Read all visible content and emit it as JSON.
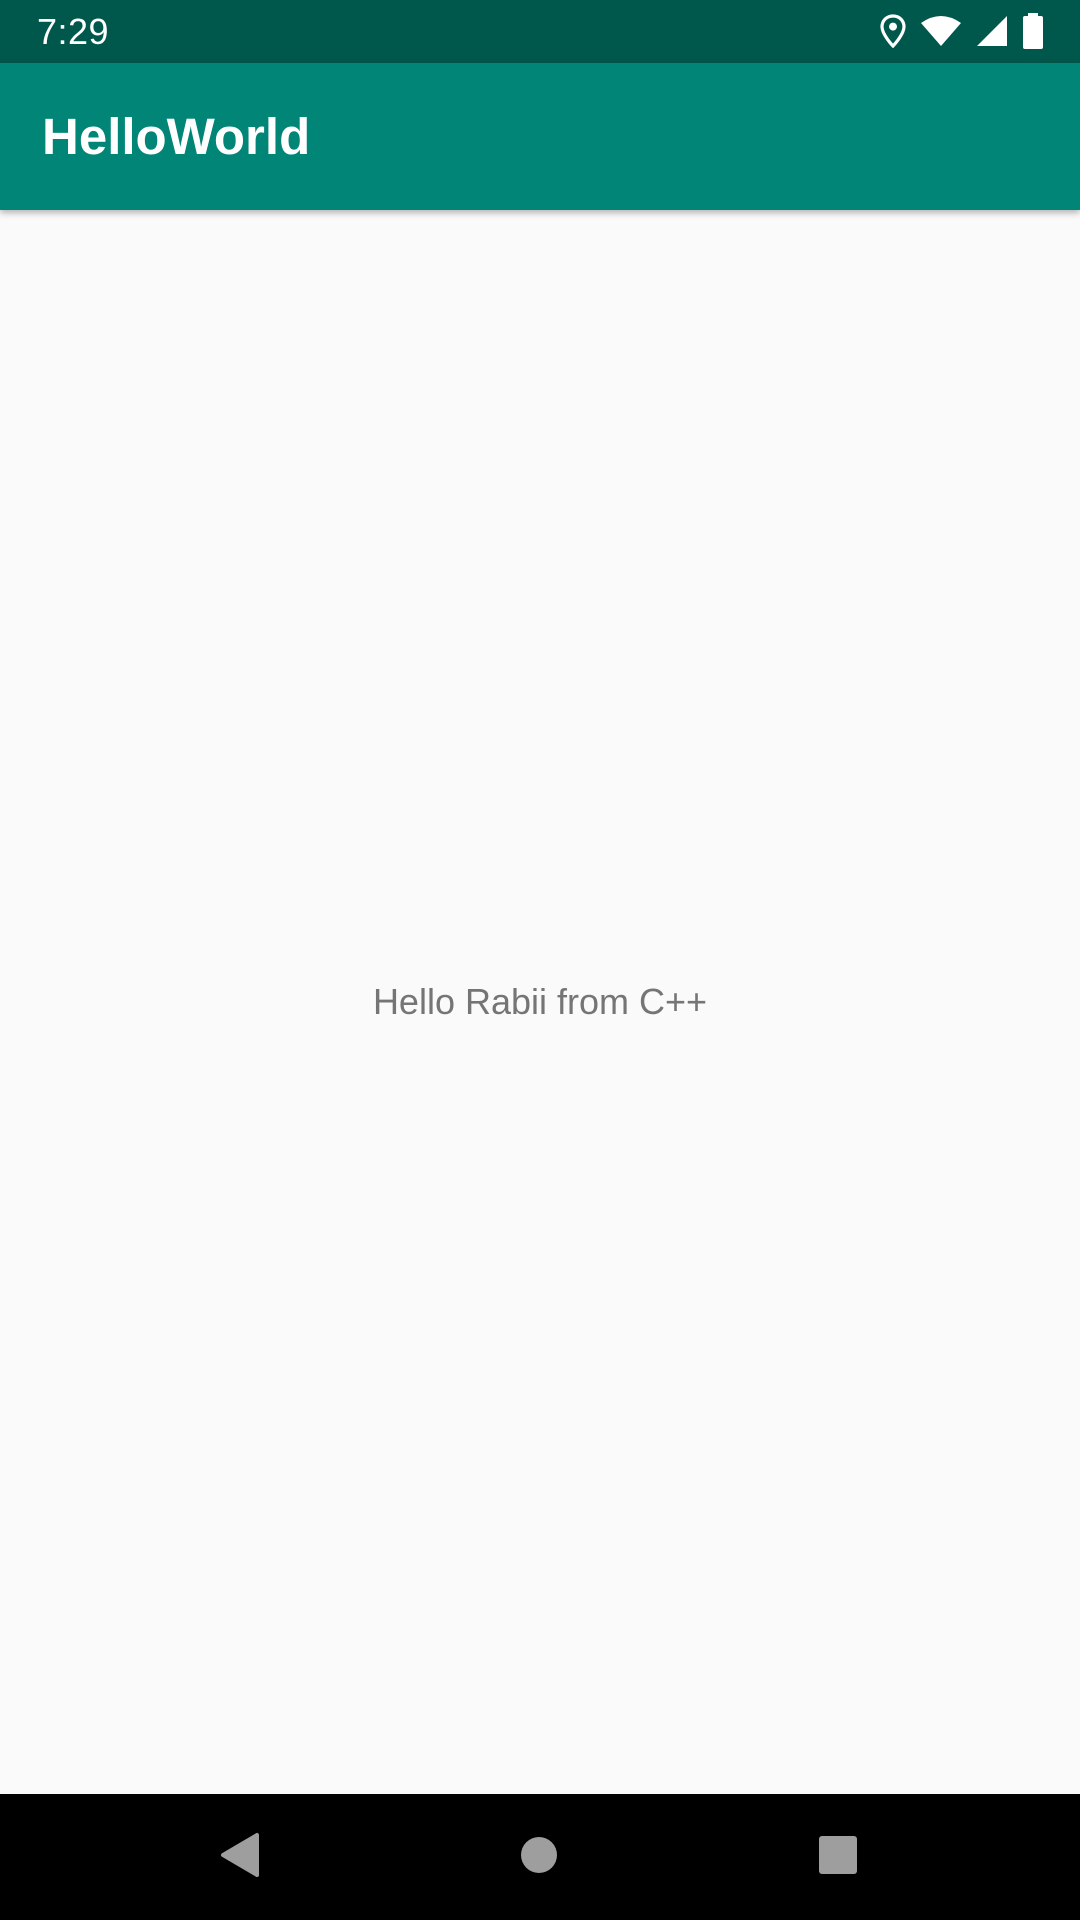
{
  "status_bar": {
    "time": "7:29",
    "icons": [
      "location-icon",
      "wifi-icon",
      "cellular-signal-icon",
      "battery-icon"
    ],
    "background": "#00574b"
  },
  "app_bar": {
    "title": "HelloWorld",
    "background": "#008577"
  },
  "main": {
    "message": "Hello Rabii from C++",
    "text_color": "#757575",
    "background": "#fafafa"
  },
  "nav_bar": {
    "buttons": [
      "back-icon",
      "home-icon",
      "recents-icon"
    ],
    "background": "#000000",
    "icon_color": "#9e9e9e"
  }
}
